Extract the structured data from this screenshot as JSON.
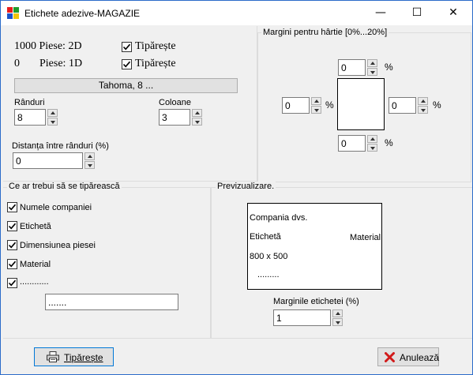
{
  "window": {
    "title": "Etichete adezive-MAGAZIE",
    "minimize": "—",
    "maximize": "☐",
    "close": "✕"
  },
  "settings": {
    "pieces_2d": "1000 Piese: 2D",
    "print_2d_label": "Tipărește",
    "print_2d_checked": true,
    "pieces_1d_count": "0",
    "pieces_1d_label": "Piese: 1D",
    "print_1d_label": "Tipărește",
    "print_1d_checked": true,
    "font_button": "Tahoma, 8 ...",
    "rows_label": "Rânduri",
    "rows_value": "8",
    "cols_label": "Coloane",
    "cols_value": "3",
    "row_spacing_label": "Distanța între rânduri (%)",
    "row_spacing_value": "0"
  },
  "margins": {
    "title": "Margini pentru hârtie [0%...20%]",
    "top": "0",
    "left": "0",
    "right": "0",
    "bottom": "0",
    "unit": "%"
  },
  "print_content": {
    "title": "Ce ar trebui să se tipărească",
    "items": [
      {
        "label": "Numele companiei",
        "checked": true
      },
      {
        "label": "Etichetă",
        "checked": true
      },
      {
        "label": "Dimensiunea piesei",
        "checked": true
      },
      {
        "label": "Material",
        "checked": true
      },
      {
        "label": "............",
        "checked": true
      }
    ],
    "extra_value": "......."
  },
  "preview": {
    "title": "Previzualizare.",
    "company": "Compania dvs.",
    "label": "Etichetă",
    "material": "Material",
    "size": "800 x 500",
    "dots": ".........",
    "margin_label": "Marginile etichetei (%)",
    "margin_value": "1"
  },
  "footer": {
    "print_button": "Tipărește",
    "cancel_button": "Anulează"
  }
}
